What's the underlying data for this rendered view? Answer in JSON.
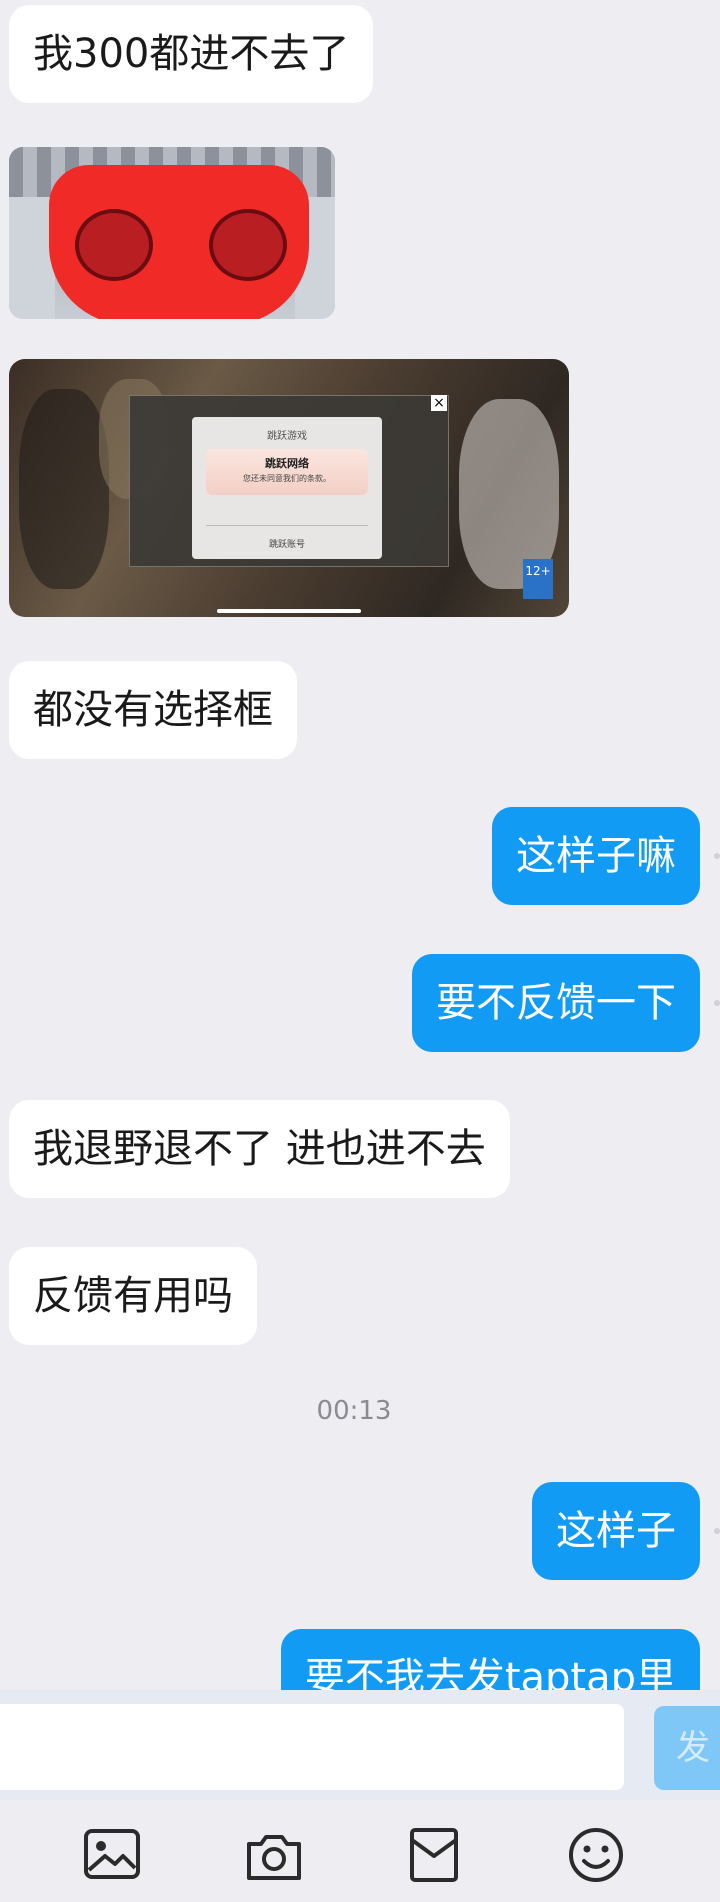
{
  "messages": [
    {
      "side": "in",
      "text": "我300都进不去了"
    },
    {
      "side": "in",
      "type": "image",
      "icon": "sticker-image"
    },
    {
      "side": "in",
      "type": "image",
      "icon": "game-screenshot-image"
    },
    {
      "side": "in",
      "text": "都没有选择框"
    },
    {
      "side": "out",
      "text": "这样子嘛"
    },
    {
      "side": "out",
      "text": "要不反馈一下"
    },
    {
      "side": "in",
      "text": "我退野退不了 进也进不去"
    },
    {
      "side": "in",
      "text": "反馈有用吗"
    },
    {
      "side": "out",
      "text": "这样子"
    },
    {
      "side": "out",
      "text": "要不我去发taptap里"
    }
  ],
  "timestamp": "00:13",
  "screenshot": {
    "dialog_title": "跳跃游戏",
    "card_title": "跳跃网络",
    "card_subtitle": "您还未同意我们的条款。",
    "account_link": "跳跃账号",
    "age_badge": "12+"
  },
  "input": {
    "value": "",
    "send_label": "发"
  },
  "toolbar": {
    "icons": [
      "image-icon",
      "camera-icon",
      "envelope-icon",
      "emoji-icon"
    ]
  },
  "colors": {
    "background": "#ededf2",
    "outgoing_bubble": "#129bf4",
    "incoming_bubble": "#ffffff",
    "send_button": "#7ec7f7"
  }
}
